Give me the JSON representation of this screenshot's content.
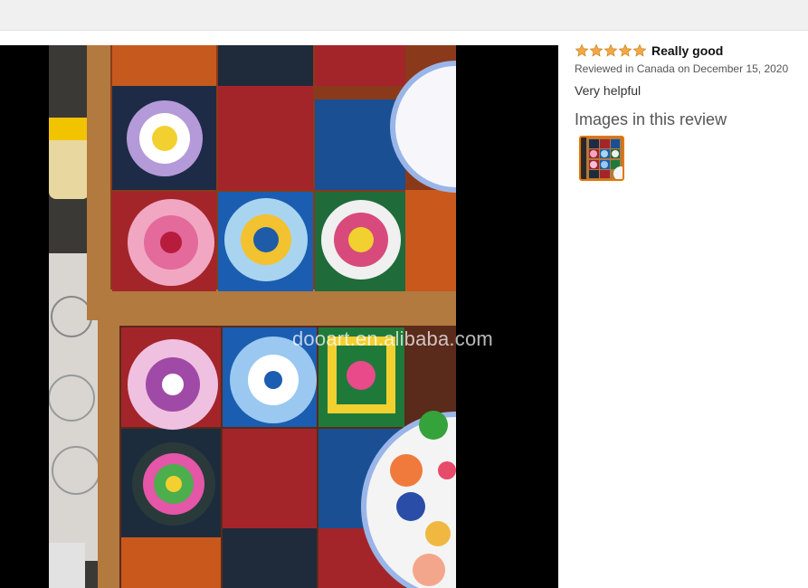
{
  "review": {
    "rating": 5,
    "rating_max": 5,
    "title": "Really good",
    "meta": "Reviewed in Canada on December 15, 2020",
    "helpful": "Very helpful",
    "images_heading": "Images in this review"
  },
  "photo": {
    "watermark": "dooart.en.alibaba.com"
  },
  "colors": {
    "star": "#f3a847",
    "thumb_border": "#e77600",
    "viewer_bg": "#000000"
  },
  "icons": [
    "star-icon",
    "image-thumbnail"
  ]
}
